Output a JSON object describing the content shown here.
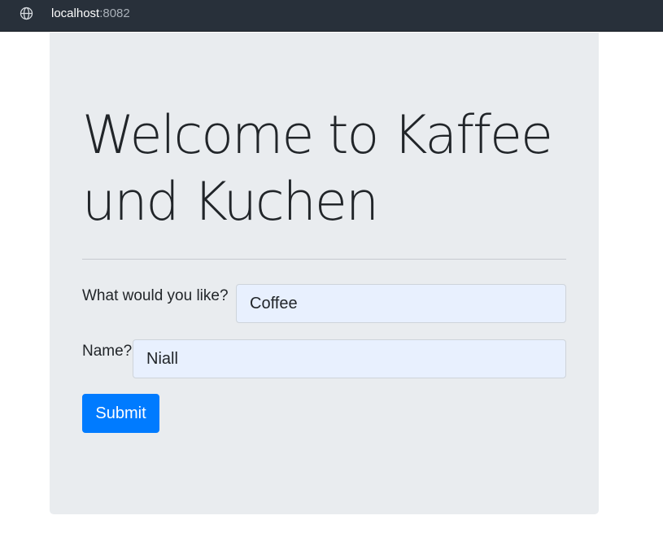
{
  "browser": {
    "host": "localhost",
    "port": ":8082",
    "icon": "globe-icon"
  },
  "page": {
    "title": "Welcome to Kaffee und Kuchen",
    "form": {
      "drink_label": "What would you like?",
      "drink_value": "Coffee",
      "name_label": "Name?",
      "name_value": "Niall",
      "submit_label": "Submit"
    }
  },
  "colors": {
    "topbar": "#28303a",
    "jumbotron": "#e9ecef",
    "input_fill": "#e8f0fe",
    "primary": "#007bff"
  }
}
